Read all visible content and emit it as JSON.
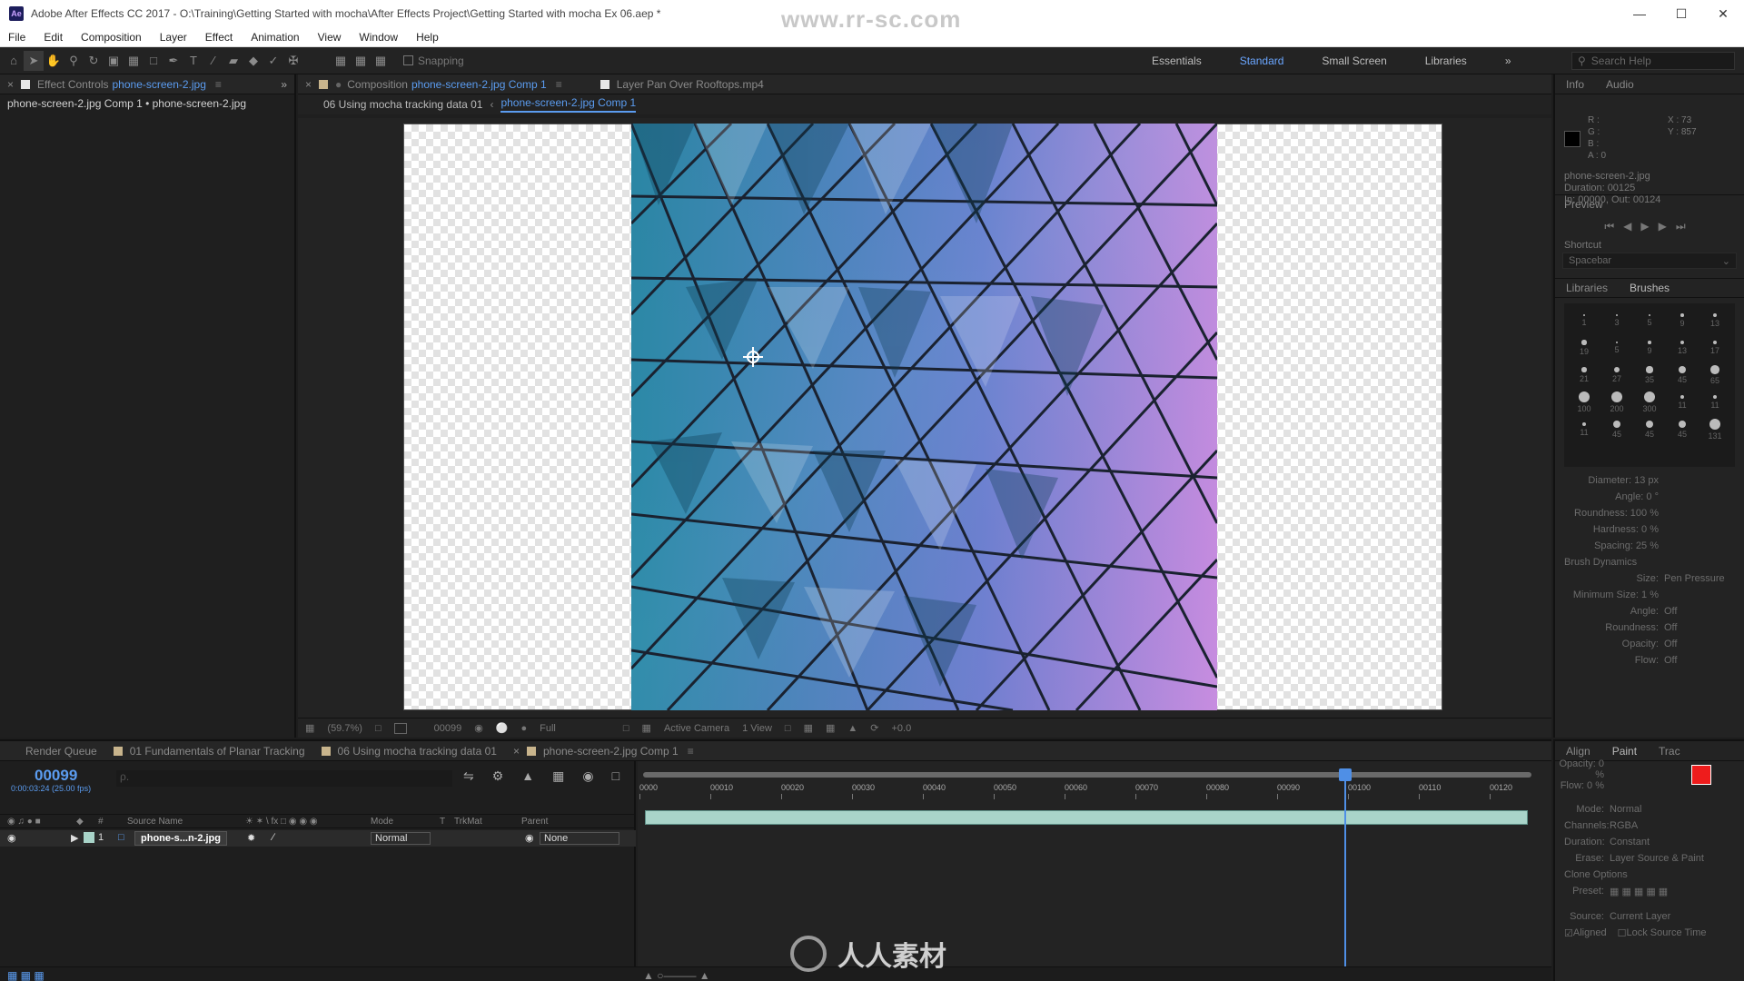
{
  "window": {
    "title": "Adobe After Effects CC 2017 - O:\\Training\\Getting Started with mocha\\After Effects Project\\Getting Started with mocha Ex 06.aep *",
    "app_icon": "Ae",
    "watermark": "www.rr-sc.com",
    "controls": [
      "minimize-icon",
      "maximize-icon",
      "close-icon"
    ]
  },
  "menu": [
    "File",
    "Edit",
    "Composition",
    "Layer",
    "Effect",
    "Animation",
    "View",
    "Window",
    "Help"
  ],
  "toolbar": {
    "snapping_label": "Snapping",
    "workspaces": [
      "Essentials",
      "Standard",
      "Small Screen",
      "Libraries"
    ],
    "active_workspace": "Standard",
    "search_placeholder": "Search Help"
  },
  "effect_controls": {
    "tab_label": "Effect Controls",
    "tab_file": "phone-screen-2.jpg",
    "subheader": "phone-screen-2.jpg Comp 1 • phone-screen-2.jpg"
  },
  "composition": {
    "tab_label": "Composition",
    "tab_name": "phone-screen-2.jpg Comp 1",
    "second_tab": "Layer  Pan Over Rooftops.mp4",
    "breadcrumb_parent": "06 Using mocha tracking data 01",
    "breadcrumb_current": "phone-screen-2.jpg Comp 1",
    "footer": {
      "zoom": "(59.7%)",
      "timecode": "00099",
      "resolution": "Full",
      "camera": "Active Camera",
      "views": "1 View",
      "exposure": "+0.0"
    }
  },
  "info_panel": {
    "tabs": [
      "Info",
      "Audio"
    ],
    "rgba": [
      "R :",
      "G :",
      "B :",
      "A : 0"
    ],
    "xy": [
      "X : 73",
      "Y : 857"
    ],
    "layer_name": "phone-screen-2.jpg",
    "duration": "Duration: 00125",
    "inout": "In: 00000, Out: 00124"
  },
  "preview_panel": {
    "tab": "Preview",
    "shortcut_label": "Shortcut",
    "shortcut_value": "Spacebar"
  },
  "brushes_panel": {
    "tabs": [
      "Libraries",
      "Brushes"
    ],
    "brush_sizes": [
      "1",
      "3",
      "5",
      "9",
      "13",
      "19",
      "5",
      "9",
      "13",
      "17",
      "21",
      "27",
      "35",
      "45",
      "65",
      "100",
      "200",
      "300",
      "11",
      "11",
      "11",
      "45",
      "45",
      "45",
      "131"
    ],
    "diameter": "Diameter: 13 px",
    "angle": "Angle: 0 °",
    "roundness": "Roundness: 100 %",
    "hardness": "Hardness: 0 %",
    "spacing": "Spacing: 25 %",
    "dynamics_label": "Brush Dynamics",
    "size": "Pen Pressure",
    "min_size": "Minimum Size: 1 %",
    "dyn_angle": "Off",
    "dyn_roundness": "Off",
    "dyn_opacity": "Off",
    "dyn_flow": "Off"
  },
  "paint_panel": {
    "tabs": [
      "Align",
      "Paint",
      "Trac"
    ],
    "opacity": "Opacity: 0 %",
    "flow": "Flow: 0 %",
    "mode": "Normal",
    "channels": "RGBA",
    "duration": "Constant",
    "erase": "Layer Source & Paint",
    "clone_options": "Clone Options",
    "preset_label": "Preset:",
    "source_label": "Source:",
    "source_value": "Current Layer",
    "aligned": "Aligned",
    "lock_source_time": "Lock Source Time",
    "fg_color": "#ee1c1c",
    "bg_color": "#ffffff"
  },
  "timeline": {
    "tabs": [
      "Render Queue",
      "01 Fundamentals of Planar Tracking",
      "06 Using mocha tracking data 01",
      "phone-screen-2.jpg Comp 1"
    ],
    "timecode": "00099",
    "timecode_sub": "0:00:03:24 (25.00 fps)",
    "search_placeholder": "ρ.",
    "columns": {
      "num": "#",
      "source_name": "Source Name",
      "mode": "Mode",
      "t": "T",
      "trkmat": "TrkMat",
      "parent": "Parent"
    },
    "layer": {
      "number": "1",
      "name": "phone-s...n-2.jpg",
      "mode": "Normal",
      "parent": "None"
    },
    "ruler_ticks": [
      "0000",
      "00010",
      "00020",
      "00030",
      "00040",
      "00050",
      "00060",
      "00070",
      "00080",
      "00090",
      "00100",
      "00110",
      "00120"
    ]
  },
  "bottom_watermark": "人人素材",
  "colors": {
    "accent": "#5b9cf0",
    "panel": "#232323",
    "layer_bar": "#a9d4c9"
  }
}
